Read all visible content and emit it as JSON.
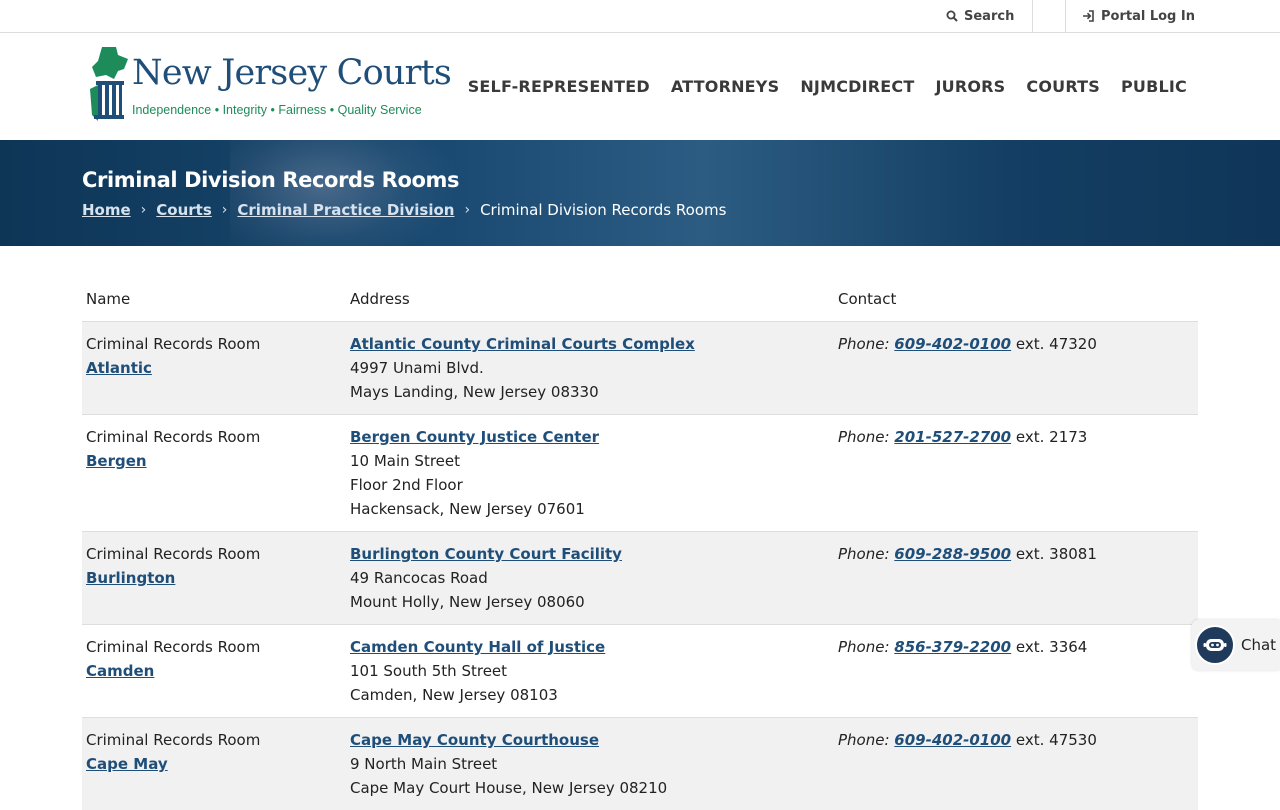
{
  "utility": {
    "search_label": "Search",
    "portal_label": "Portal Log In"
  },
  "header": {
    "logo_title": "New Jersey Courts",
    "logo_tagline": "Independence • Integrity • Fairness • Quality Service"
  },
  "nav": {
    "items": [
      {
        "label": "SELF-REPRESENTED"
      },
      {
        "label": "ATTORNEYS"
      },
      {
        "label": "NJMCDIRECT"
      },
      {
        "label": "JURORS"
      },
      {
        "label": "COURTS"
      },
      {
        "label": "PUBLIC"
      }
    ]
  },
  "banner": {
    "title": "Criminal Division Records Rooms",
    "breadcrumb": [
      {
        "label": "Home"
      },
      {
        "label": "Courts"
      },
      {
        "label": "Criminal Practice Division"
      }
    ],
    "current": "Criminal Division Records Rooms"
  },
  "table": {
    "headers": {
      "name": "Name",
      "address": "Address",
      "contact": "Contact"
    },
    "phone_label": "Phone",
    "rows": [
      {
        "name_prefix": "Criminal Records Room",
        "county": "Atlantic",
        "facility": "Atlantic County Criminal Courts Complex",
        "address_lines": [
          "4997 Unami Blvd.",
          "Mays Landing, New Jersey 08330"
        ],
        "phone": "609-402-0100",
        "ext": "ext. 47320"
      },
      {
        "name_prefix": "Criminal Records Room",
        "county": "Bergen",
        "facility": "Bergen County Justice Center",
        "address_lines": [
          "10 Main Street",
          "Floor 2nd Floor",
          "Hackensack, New Jersey 07601"
        ],
        "phone": "201-527-2700",
        "ext": "ext. 2173"
      },
      {
        "name_prefix": "Criminal Records Room",
        "county": "Burlington",
        "facility": "Burlington County Court Facility",
        "address_lines": [
          "49 Rancocas Road",
          "Mount Holly, New Jersey 08060"
        ],
        "phone": "609-288-9500",
        "ext": "ext. 38081"
      },
      {
        "name_prefix": "Criminal Records Room",
        "county": "Camden",
        "facility": "Camden County Hall of Justice",
        "address_lines": [
          "101 South 5th Street",
          "Camden, New Jersey 08103"
        ],
        "phone": "856-379-2200",
        "ext": "ext. 3364"
      },
      {
        "name_prefix": "Criminal Records Room",
        "county": "Cape May",
        "facility": "Cape May County Courthouse",
        "address_lines": [
          "9 North Main Street",
          "Cape May Court House, New Jersey 08210"
        ],
        "phone": "609-402-0100",
        "ext": "ext. 47530"
      }
    ]
  },
  "chat": {
    "label": "Chat"
  },
  "colors": {
    "brand_blue": "#1f4e79",
    "brand_green": "#1e8c5a",
    "banner_navy": "#0d3556",
    "row_shade": "#f1f1f1"
  }
}
